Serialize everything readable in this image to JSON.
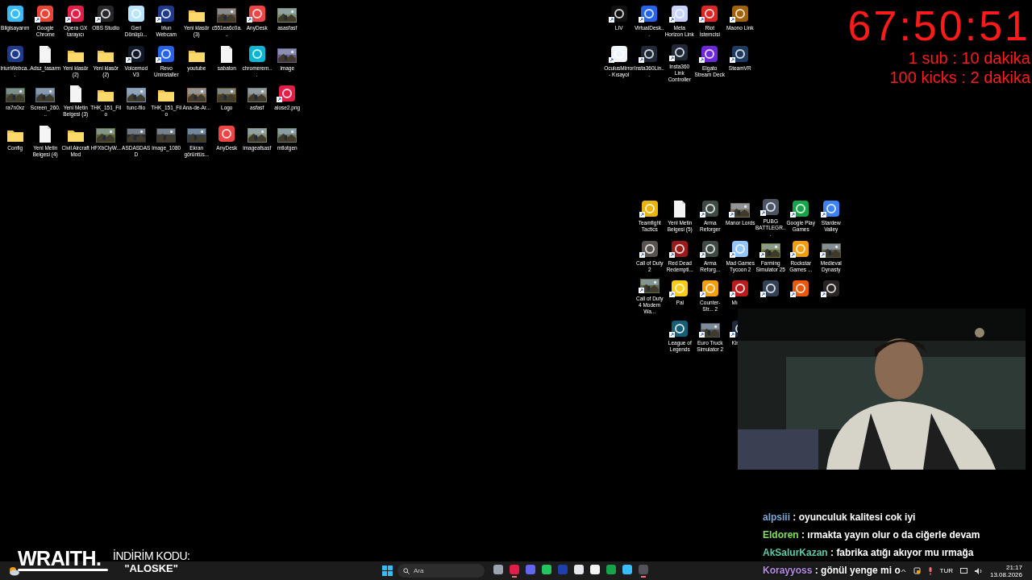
{
  "desktop_left": [
    {
      "label": "Bilgisayarım",
      "kind": "app",
      "color": "#38bdf8",
      "shortcut": false
    },
    {
      "label": "Google Chrome",
      "kind": "app",
      "color": "#ea4335",
      "shortcut": true
    },
    {
      "label": "Opera GX tarayıcı",
      "kind": "app",
      "color": "#e11d48",
      "shortcut": true
    },
    {
      "label": "OBS Studio",
      "kind": "app",
      "color": "#27272a",
      "shortcut": true
    },
    {
      "label": "Geri Dönüşü...",
      "kind": "app",
      "color": "#bae6fd",
      "shortcut": false
    },
    {
      "label": "Iriun Webcam",
      "kind": "app",
      "color": "#1e3a8a",
      "shortcut": true
    },
    {
      "label": "Yeni klasör (3)",
      "kind": "folder",
      "shortcut": false
    },
    {
      "label": "c551ea6c0a...",
      "color": "#6b4f3a",
      "shortcut": false
    },
    {
      "label": "AnyDesk",
      "kind": "app",
      "color": "#ef4444",
      "shortcut": true
    },
    {
      "label": "asasfasf",
      "color": "#7c8b6a",
      "shortcut": false
    },
    {
      "label": "IriunWebca...",
      "kind": "app",
      "color": "#1e3a8a",
      "shortcut": false
    },
    {
      "label": "Adsz_tasarm",
      "kind": "file",
      "shortcut": false
    },
    {
      "label": "Yeni klasör (2)",
      "kind": "folder",
      "shortcut": false
    },
    {
      "label": "Yeni klasör (2)",
      "kind": "folder",
      "shortcut": false
    },
    {
      "label": "Voicemod V3",
      "kind": "app",
      "color": "#111827",
      "shortcut": true
    },
    {
      "label": "Revo Uninstaller",
      "kind": "app",
      "color": "#2563eb",
      "shortcut": true
    },
    {
      "label": "youtube",
      "kind": "folder",
      "shortcut": false
    },
    {
      "label": "sabaton",
      "kind": "file",
      "shortcut": false
    },
    {
      "label": "chromerem...",
      "kind": "app",
      "color": "#06b6d4",
      "shortcut": false
    },
    {
      "label": "image",
      "color": "#6d5b8a",
      "shortcut": false
    },
    {
      "label": "ra7n0xz",
      "color": "#4d5b3a",
      "shortcut": false
    },
    {
      "label": "Screen_260...",
      "color": "#64748b",
      "shortcut": false
    },
    {
      "label": "Yeni Metin Belgesi (3)",
      "kind": "file",
      "shortcut": false
    },
    {
      "label": "THK_151_Filo",
      "kind": "folder",
      "shortcut": false
    },
    {
      "label": "tunc-filo",
      "color": "#7890a8",
      "shortcut": false
    },
    {
      "label": "THK_151_Filo",
      "kind": "folder",
      "shortcut": false
    },
    {
      "label": "Ana-de-Ar...",
      "color": "#8a6a4a",
      "shortcut": false
    },
    {
      "label": "Logo",
      "color": "#5a4a1a",
      "shortcut": false
    },
    {
      "label": "asfasf",
      "color": "#7c7a6a",
      "shortcut": false
    },
    {
      "label": "alose2.png",
      "kind": "app",
      "color": "#e11d48",
      "shortcut": true
    },
    {
      "label": "Config",
      "kind": "folder",
      "shortcut": false
    },
    {
      "label": "Yeni Metin Belgesi (4)",
      "kind": "file",
      "shortcut": false
    },
    {
      "label": "Civil Aircraft Mod",
      "kind": "folder",
      "shortcut": false
    },
    {
      "label": "HFXbClyW...",
      "color": "#5a6a2a",
      "shortcut": false
    },
    {
      "label": "ASDASDASD",
      "color": "#2a2a2a",
      "shortcut": false
    },
    {
      "label": "image_1080",
      "color": "#3a3a3a",
      "shortcut": false
    },
    {
      "label": "Ekran görüntüs...",
      "color": "#334155",
      "shortcut": false
    },
    {
      "label": "AnyDesk",
      "kind": "app",
      "color": "#ef4444",
      "shortcut": false
    },
    {
      "label": "imageafsasf",
      "color": "#7c8b6a",
      "shortcut": false
    },
    {
      "label": "mtlotgen",
      "color": "#6a7a6a",
      "shortcut": false
    }
  ],
  "desktop_top_right": [
    {
      "label": "LIV",
      "kind": "app",
      "color": "#111111",
      "shortcut": true
    },
    {
      "label": "VirtualDesk...",
      "kind": "app",
      "color": "#2563eb",
      "shortcut": true
    },
    {
      "label": "Meta Horizon Link",
      "kind": "app",
      "color": "#c7d2fe",
      "shortcut": true
    },
    {
      "label": "Riot İstemcisi",
      "kind": "app",
      "color": "#dc2626",
      "shortcut": true
    },
    {
      "label": "Maono Link",
      "kind": "app",
      "color": "#a16207",
      "shortcut": true
    },
    {
      "label": "OculusMirror - Kısayol",
      "kind": "app",
      "color": "#f1f5f9",
      "shortcut": true
    },
    {
      "label": "Insta360Lin...",
      "kind": "app",
      "color": "#1f2937",
      "shortcut": true
    },
    {
      "label": "Insta360 Link Controller",
      "kind": "app",
      "color": "#1f2937",
      "shortcut": true
    },
    {
      "label": "Elgato Stream Deck",
      "kind": "app",
      "color": "#6d28d9",
      "shortcut": true
    },
    {
      "label": "SteamVR",
      "kind": "app",
      "color": "#1e3a5f",
      "shortcut": true
    }
  ],
  "desktop_games": [
    {
      "label": "Teamfight Tactics",
      "kind": "app",
      "color": "#eab308",
      "shortcut": true
    },
    {
      "label": "Yeni Metin Belgesi (5)",
      "kind": "file",
      "shortcut": false
    },
    {
      "label": "Arma Reforger",
      "kind": "app",
      "color": "#3f4a44",
      "shortcut": true
    },
    {
      "label": "Manor Lords",
      "color": "#7a6a5a",
      "shortcut": true
    },
    {
      "label": "PUBG BATTLEGR...",
      "kind": "app",
      "color": "#4b5563",
      "shortcut": true
    },
    {
      "label": "Google Play Games",
      "kind": "app",
      "color": "#16a34a",
      "shortcut": true
    },
    {
      "label": "Stardew Valley",
      "kind": "app",
      "color": "#3b82f6",
      "shortcut": true
    },
    {
      "label": "Call of Duty 2",
      "kind": "app",
      "color": "#57534e",
      "shortcut": true
    },
    {
      "label": "Red Dead Redempti...",
      "kind": "app",
      "color": "#991b1b",
      "shortcut": true
    },
    {
      "label": "Arma Reforg...",
      "kind": "app",
      "color": "#3f4a44",
      "shortcut": true
    },
    {
      "label": "Mad Games Tycoon 2",
      "kind": "app",
      "color": "#93c5fd",
      "shortcut": true
    },
    {
      "label": "Farming Simulator 25",
      "color": "#6b7a3a",
      "shortcut": true
    },
    {
      "label": "Rockstar Games ...",
      "kind": "app",
      "color": "#f59e0b",
      "shortcut": true
    },
    {
      "label": "Medieval Dynasty",
      "color": "#5a5a4a",
      "shortcut": true
    },
    {
      "label": "Call of Duty 4 Modern Wa...",
      "color": "#5a6a4a",
      "shortcut": true
    },
    {
      "label": "Pal",
      "kind": "app",
      "color": "#facc15",
      "shortcut": true
    },
    {
      "label": "Counter-Str... 2",
      "kind": "app",
      "color": "#f59e0b",
      "shortcut": true
    },
    {
      "label": "Mı",
      "kind": "app",
      "color": "#b91c1c",
      "shortcut": true,
      "cut": true
    },
    {
      "kind": "app",
      "color": "#334155",
      "shortcut": true
    },
    {
      "kind": "app",
      "color": "#ea580c",
      "shortcut": true
    },
    {
      "kind": "app",
      "color": "#292524",
      "shortcut": true
    },
    {
      "kind": "empty"
    },
    {
      "label": "League of Legends",
      "kind": "app",
      "color": "#155e75",
      "shortcut": true
    },
    {
      "label": "Euro Truck Simulator 2",
      "color": "#52525b",
      "shortcut": true
    },
    {
      "label": "Kin",
      "kind": "app",
      "color": "#1e293b",
      "shortcut": true,
      "cut": true
    }
  ],
  "timer": {
    "time": "67:50:51",
    "lines": [
      "1 sub : 10 dakika",
      "100 kicks : 2 dakika"
    ]
  },
  "chat": [
    {
      "user": "alpsiii",
      "color": "#7ba7d9",
      "message": ": oyunculuk kalitesi cok iyi"
    },
    {
      "user": "Eldoren",
      "color": "#7ee05a",
      "message": ": ırmakta yayın olur o da ciğerle devam"
    },
    {
      "user": "AkSalurKazan",
      "color": "#5cc9a8",
      "message": ": fabrika atığı akıyor mu ırmağa"
    },
    {
      "user": "Korayyoss",
      "color": "#b58ce6",
      "message": ": gönül yenge mi o"
    }
  ],
  "sponsor": {
    "brand": "WRAITH.",
    "title": "İNDİRİM KODU:",
    "code": "\"ALOSKE\""
  },
  "taskbar": {
    "search_placeholder": "Ara",
    "apps": [
      {
        "color": "#9ca3af",
        "active": false
      },
      {
        "color": "#e11d48",
        "active": true
      },
      {
        "color": "#6366f1",
        "active": false
      },
      {
        "color": "#22c55e",
        "active": false
      },
      {
        "color": "#1e40af",
        "active": false
      },
      {
        "color": "#e5e7eb",
        "active": false
      },
      {
        "color": "#f4f4f5",
        "active": false
      },
      {
        "color": "#16a34a",
        "active": false
      },
      {
        "color": "#38bdf8",
        "active": false
      },
      {
        "color": "#52525b",
        "active": true
      }
    ],
    "language": "TUR",
    "time": "21:17",
    "date": "13.08.2026"
  }
}
